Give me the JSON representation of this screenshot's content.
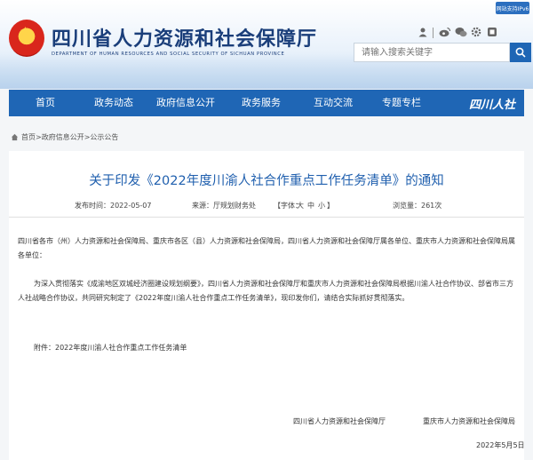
{
  "header": {
    "site_title": "四川省人力资源和社会保障厅",
    "site_subtitle": "DEPARTMENT OF HUMAN RESOURCES AND SOCIAL SECURITY OF SICHUAN PROVINCE",
    "elder_mode": "网站支持IPv6",
    "search_placeholder": "请输入搜索关键字",
    "social_sep": "|",
    "social_icons": [
      "person-icon",
      "weibo-icon",
      "wechat-icon",
      "gear-icon",
      "app-icon"
    ],
    "brand_color": "#1f66b5"
  },
  "nav": {
    "items": [
      "首页",
      "政务动态",
      "政府信息公开",
      "政务服务",
      "互动交流",
      "专题专栏"
    ],
    "logo_text": "四川人社"
  },
  "breadcrumb": {
    "items": [
      "首页",
      "政府信息公开",
      "公示公告"
    ],
    "separator": ">"
  },
  "article": {
    "title": "关于印发《2022年度川渝人社合作重点工作任务清单》的通知",
    "meta": {
      "date": "发布时间：2022-05-07",
      "source": "来源：厅规划财务处",
      "font_label": "【字体：",
      "font_large": "大",
      "font_medium": "中",
      "font_small": "小",
      "font_end": "】",
      "views": "浏览量：261次"
    },
    "salutation": "四川省各市（州）人力资源和社会保障局、重庆市各区（县）人力资源和社会保障局，四川省人力资源和社会保障厅属各单位、重庆市人力资源和社会保障局属各单位：",
    "body": "为深入贯彻落实《成渝地区双城经济圈建设规划纲要》，四川省人力资源和社会保障厅和重庆市人力资源和社会保障局根据川渝人社合作协议、部省市三方人社战略合作协议，共同研究制定了《2022年度川渝人社合作重点工作任务清单》，现印发你们，请结合实际抓好贯彻落实。",
    "attachment": "附件：2022年度川渝人社合作重点工作任务清单",
    "signature_left": "四川省人力资源和社会保障厅",
    "signature_right": "重庆市人力资源和社会保障局",
    "sign_date": "2022年5月5日"
  }
}
